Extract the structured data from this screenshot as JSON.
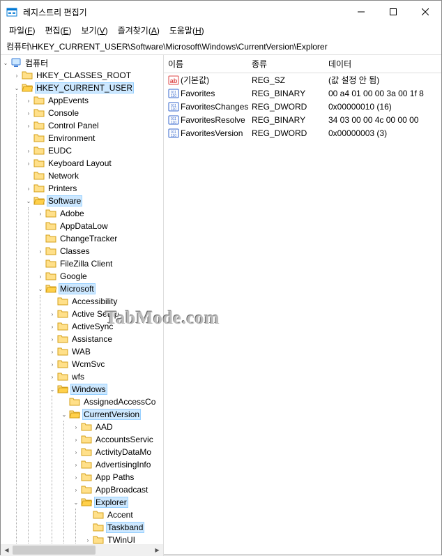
{
  "window": {
    "title": "레지스트리 편집기"
  },
  "menu": {
    "file": "파일",
    "file_u": "F",
    "edit": "편집",
    "edit_u": "E",
    "view": "보기",
    "view_u": "V",
    "fav": "즐겨찾기",
    "fav_u": "A",
    "help": "도움말",
    "help_u": "H"
  },
  "address": "컴퓨터\\HKEY_CURRENT_USER\\Software\\Microsoft\\Windows\\CurrentVersion\\Explorer",
  "list": {
    "cols": {
      "name": "이름",
      "type": "종류",
      "data": "데이터"
    },
    "rows": [
      {
        "icon": "str",
        "name": "(기본값)",
        "type": "REG_SZ",
        "data": "(값 설정 안 됨)"
      },
      {
        "icon": "bin",
        "name": "Favorites",
        "type": "REG_BINARY",
        "data": "00 a4 01 00 00 3a 00 1f 8"
      },
      {
        "icon": "bin",
        "name": "FavoritesChanges",
        "type": "REG_DWORD",
        "data": "0x00000010 (16)"
      },
      {
        "icon": "bin",
        "name": "FavoritesResolve",
        "type": "REG_BINARY",
        "data": "34 03 00 00 4c 00 00 00"
      },
      {
        "icon": "bin",
        "name": "FavoritesVersion",
        "type": "REG_DWORD",
        "data": "0x00000003 (3)"
      }
    ]
  },
  "tree": {
    "root": "컴퓨터",
    "hives": [
      {
        "label": "HKEY_CLASSES_ROOT",
        "open": false,
        "has": true
      },
      {
        "label": "HKEY_CURRENT_USER",
        "open": true,
        "sel": true,
        "has": true,
        "children": [
          {
            "label": "AppEvents",
            "has": true
          },
          {
            "label": "Console",
            "has": true
          },
          {
            "label": "Control Panel",
            "has": true
          },
          {
            "label": "Environment",
            "has": false
          },
          {
            "label": "EUDC",
            "has": true
          },
          {
            "label": "Keyboard Layout",
            "has": true
          },
          {
            "label": "Network",
            "has": false
          },
          {
            "label": "Printers",
            "has": true
          },
          {
            "label": "Software",
            "open": true,
            "sel": true,
            "has": true,
            "children": [
              {
                "label": "Adobe",
                "has": true
              },
              {
                "label": "AppDataLow",
                "has": false
              },
              {
                "label": "ChangeTracker",
                "has": false
              },
              {
                "label": "Classes",
                "has": true
              },
              {
                "label": "FileZilla Client",
                "has": false
              },
              {
                "label": "Google",
                "has": true
              },
              {
                "label": "Microsoft",
                "open": true,
                "sel": true,
                "has": true,
                "children": [
                  {
                    "label": "Accessibility",
                    "has": false
                  },
                  {
                    "label": "Active Setup",
                    "has": true
                  },
                  {
                    "label": "ActiveSync",
                    "has": true
                  },
                  {
                    "label": "Assistance",
                    "has": true
                  },
                  {
                    "label": "WAB",
                    "has": true
                  },
                  {
                    "label": "WcmSvc",
                    "has": true
                  },
                  {
                    "label": "wfs",
                    "has": true
                  },
                  {
                    "label": "Windows",
                    "open": true,
                    "sel": true,
                    "has": true,
                    "children": [
                      {
                        "label": "AssignedAccessCo",
                        "has": false
                      },
                      {
                        "label": "CurrentVersion",
                        "open": true,
                        "sel": true,
                        "has": true,
                        "children": [
                          {
                            "label": "AAD",
                            "has": true
                          },
                          {
                            "label": "AccountsServic",
                            "has": true
                          },
                          {
                            "label": "ActivityDataMo",
                            "has": true
                          },
                          {
                            "label": "AdvertisingInfo",
                            "has": true
                          },
                          {
                            "label": "App Paths",
                            "has": true
                          },
                          {
                            "label": "AppBroadcast",
                            "has": true
                          },
                          {
                            "label": "Explorer",
                            "open": true,
                            "sel": true,
                            "has": true,
                            "children": [
                              {
                                "label": "Accent",
                                "has": false
                              },
                              {
                                "label": "Taskband",
                                "sel": true,
                                "has": false
                              },
                              {
                                "label": "TWinUI",
                                "has": true
                              }
                            ]
                          }
                        ]
                      }
                    ]
                  }
                ]
              }
            ]
          }
        ]
      }
    ]
  },
  "watermark": "TabMode.com"
}
